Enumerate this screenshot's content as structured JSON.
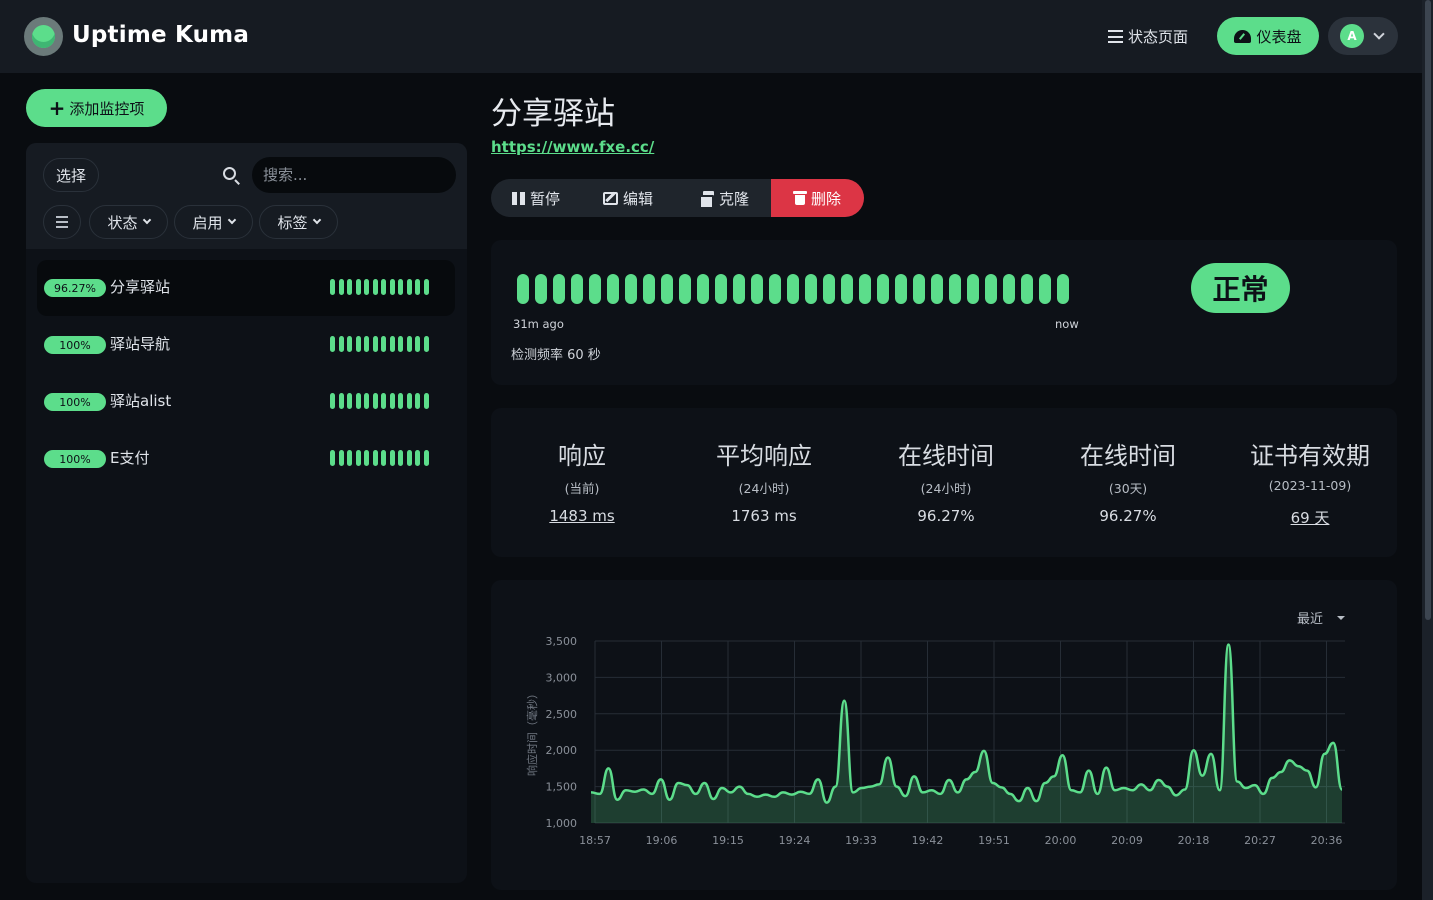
{
  "header": {
    "brand": "Uptime Kuma",
    "status_page_label": "状态页面",
    "dashboard_label": "仪表盘",
    "avatar_letter": "A",
    "accent": "#5cdd8b"
  },
  "sidebar": {
    "add_label": "添加监控项",
    "select_label": "选择",
    "search_placeholder": "搜索...",
    "filters": [
      "状态",
      "启用",
      "标签"
    ],
    "monitors": [
      {
        "uptime": "96.27%",
        "name": "分享驿站",
        "active": true
      },
      {
        "uptime": "100%",
        "name": "驿站导航",
        "active": false
      },
      {
        "uptime": "100%",
        "name": "驿站alist",
        "active": false
      },
      {
        "uptime": "100%",
        "name": "E支付",
        "active": false
      }
    ]
  },
  "main": {
    "title": "分享驿站",
    "url": "https://www.fxe.cc/",
    "actions": {
      "pause": "暂停",
      "edit": "编辑",
      "clone": "克隆",
      "delete": "删除"
    },
    "heartbeat": {
      "start_label": "31m ago",
      "end_label": "now",
      "interval_label": "检测频率 60 秒",
      "status": "正常",
      "status_color": "#5cdd8b",
      "danger_color": "#dc3545"
    },
    "stats": [
      {
        "heading": "响应",
        "sub": "(当前)",
        "value": "1483 ms",
        "link": true
      },
      {
        "heading": "平均响应",
        "sub": "(24小时)",
        "value": "1763 ms",
        "link": false
      },
      {
        "heading": "在线时间",
        "sub": "(24小时)",
        "value": "96.27%",
        "link": false
      },
      {
        "heading": "在线时间",
        "sub": "(30天)",
        "value": "96.27%",
        "link": false
      },
      {
        "heading": "证书有效期",
        "sub": "(2023-11-09)",
        "value": "69 天",
        "link": true
      }
    ],
    "range_label": "最近"
  },
  "chart_data": {
    "type": "area",
    "ylabel": "响应时间（毫秒）",
    "ylim": [
      1000,
      3500
    ],
    "yticks": [
      "1,000",
      "1,500",
      "2,000",
      "2,500",
      "3,000",
      "3,500"
    ],
    "xticks": [
      "18:57",
      "19:06",
      "19:15",
      "19:24",
      "19:33",
      "19:42",
      "19:51",
      "20:00",
      "20:09",
      "20:18",
      "20:27",
      "20:36"
    ],
    "grid": true,
    "line_color": "#5cdd8b",
    "series": [
      {
        "values": [
          1420,
          1400,
          1750,
          1320,
          1450,
          1430,
          1460,
          1400,
          1600,
          1320,
          1550,
          1520,
          1400,
          1550,
          1330,
          1480,
          1420,
          1500,
          1400,
          1360,
          1390,
          1360,
          1420,
          1390,
          1430,
          1400,
          1600,
          1280,
          1500,
          2680,
          1420,
          1480,
          1500,
          1530,
          1900,
          1500,
          1370,
          1640,
          1420,
          1450,
          1400,
          1590,
          1420,
          1600,
          1700,
          1990,
          1550,
          1490,
          1400,
          1300,
          1480,
          1300,
          1550,
          1640,
          1930,
          1450,
          1420,
          1720,
          1400,
          1760,
          1450,
          1480,
          1450,
          1530,
          1450,
          1590,
          1500,
          1380,
          1460,
          2000,
          1650,
          1950,
          1450,
          3450,
          1570,
          1480,
          1520,
          1400,
          1620,
          1700,
          1860,
          1780,
          1720,
          1490,
          1950,
          2100,
          1460
        ]
      }
    ]
  }
}
